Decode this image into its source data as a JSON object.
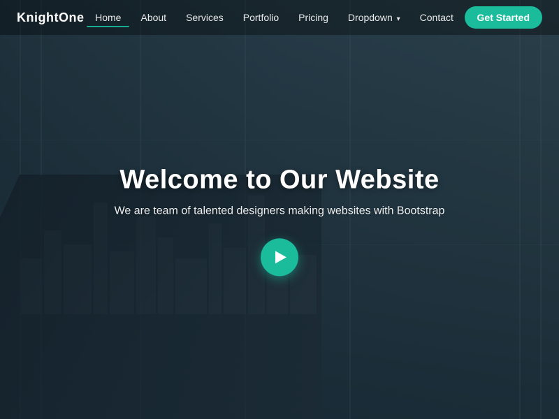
{
  "brand": {
    "name": "KnightOne"
  },
  "nav": {
    "links": [
      {
        "label": "Home",
        "active": true
      },
      {
        "label": "About",
        "active": false
      },
      {
        "label": "Services",
        "active": false
      },
      {
        "label": "Portfolio",
        "active": false
      },
      {
        "label": "Pricing",
        "active": false
      },
      {
        "label": "Dropdown",
        "active": false,
        "hasDropdown": true
      },
      {
        "label": "Contact",
        "active": false
      }
    ],
    "cta_label": "Get Started"
  },
  "hero": {
    "title": "Welcome to Our Website",
    "subtitle": "We are team of talented designers making websites with Bootstrap",
    "play_button_label": "Play video"
  },
  "colors": {
    "accent": "#1abc9c",
    "nav_bg": "rgba(0,0,0,0.35)",
    "overlay": "rgba(15,30,40,0.55)"
  }
}
